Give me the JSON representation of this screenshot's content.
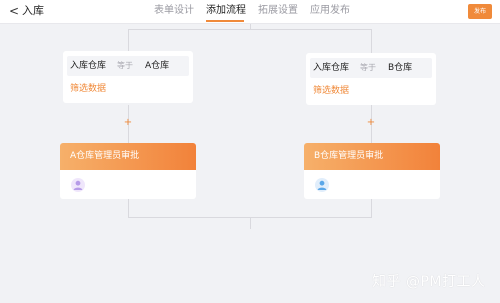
{
  "header": {
    "back_glyph": "<",
    "title": "入库",
    "tabs": [
      {
        "label": "表单设计",
        "active": false
      },
      {
        "label": "添加流程",
        "active": true
      },
      {
        "label": "拓展设置",
        "active": false
      },
      {
        "label": "应用发布",
        "active": false
      }
    ],
    "publish_label": "发布",
    "accent_color": "#f08a3a"
  },
  "flow": {
    "branches": [
      {
        "condition": {
          "field": "入库仓库",
          "operator": "等于",
          "value": "A仓库"
        },
        "filter_link": "筛选数据",
        "add_glyph": "+",
        "approval_title": "A仓库管理员审批",
        "avatar_icon": "user-icon",
        "avatar_color": "#b69be8"
      },
      {
        "condition": {
          "field": "入库仓库",
          "operator": "等于",
          "value": "B仓库"
        },
        "filter_link": "筛选数据",
        "add_glyph": "+",
        "approval_title": "B仓库管理员审批",
        "avatar_icon": "user-icon",
        "avatar_color": "#5aa7e8"
      }
    ]
  },
  "watermark": "知乎 @PM打工人"
}
